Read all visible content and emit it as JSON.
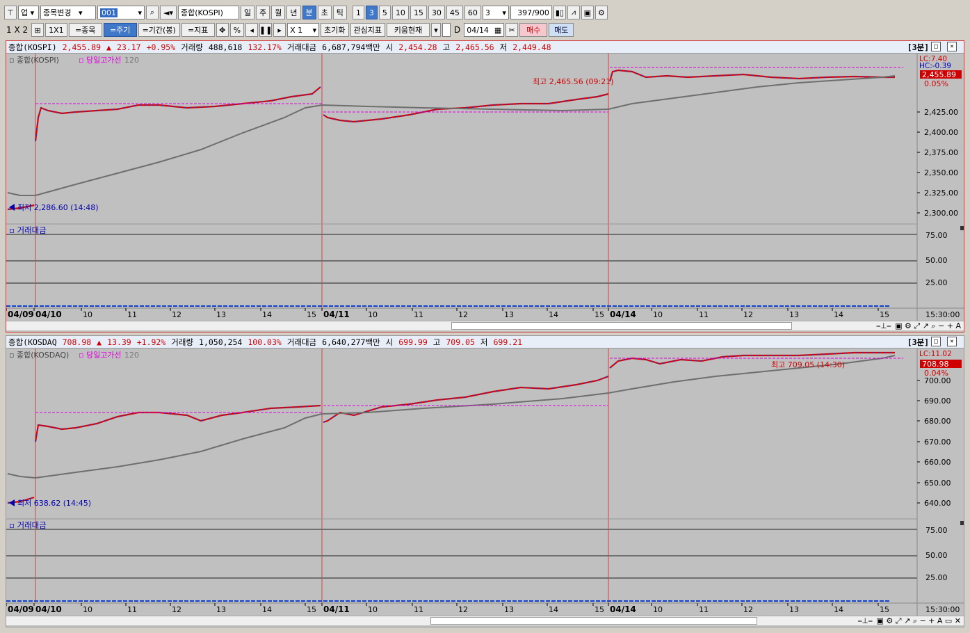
{
  "toolbar1": {
    "market": "업",
    "stock_change": "종목변경",
    "code": "001",
    "name": "종합(KOSPI)",
    "periods": [
      "일",
      "주",
      "월",
      "년",
      "분",
      "초",
      "틱"
    ],
    "active_period": "분",
    "intervals": [
      "1",
      "3",
      "5",
      "10",
      "15",
      "30",
      "45",
      "60"
    ],
    "active_interval": "3",
    "interval_value": "3",
    "count": "397",
    "count_max": "/900"
  },
  "toolbar2": {
    "layout": "1 X 2",
    "grid_btn": "1X1",
    "same_stock": "=종목",
    "same_period": "=주기",
    "same_range": "=기간(봉)",
    "same_indicator": "=지표",
    "percent": "%",
    "multiplier": "X 1",
    "reset": "초기화",
    "watch_indicator": "관심지표",
    "kiwoom_current": "키움현재",
    "d_label": "D",
    "date": "04/14",
    "buy": "매수",
    "sell": "매도"
  },
  "panel1": {
    "name": "종합(KOSPI)",
    "price": "2,455.89",
    "change": "23.17",
    "change_pct": "+0.95%",
    "volume_label": "거래량",
    "volume": "488,618",
    "volume_pct": "132.17%",
    "amount_label": "거래대금",
    "amount": "6,687,794백만",
    "open_label": "시",
    "open": "2,454.28",
    "high_label": "고",
    "high": "2,465.56",
    "low_label": "저",
    "low": "2,449.48",
    "frame": "[3분]",
    "legend_name": "종합(KOSPI)",
    "legend_line": "당일고가선",
    "legend_ma": "120",
    "max_note": "최고 2,465.56 (09:21)",
    "min_note": "최저 2,286.60 (14:48)",
    "lc_label": "LC:7.40",
    "hc_label": "HC:-0.39",
    "price_tag": "2,455.89",
    "pct_tag": "0.05%",
    "y_ticks": [
      "2,425.00",
      "2,400.00",
      "2,375.00",
      "2,350.00",
      "2,325.00",
      "2,300.00"
    ],
    "sub_title": "거래대금",
    "sub_ticks": [
      "75.00",
      "50.00",
      "25.00"
    ],
    "time_label": "15:30:00"
  },
  "panel2": {
    "name": "종합(KOSDAQ",
    "price": "708.98",
    "change": "13.39",
    "change_pct": "+1.92%",
    "volume_label": "거래량",
    "volume": "1,050,254",
    "volume_pct": "100.03%",
    "amount_label": "거래대금",
    "amount": "6,640,277백만",
    "open_label": "시",
    "open": "699.99",
    "high_label": "고",
    "high": "709.05",
    "low_label": "저",
    "low": "699.21",
    "frame": "[3분]",
    "legend_name": "종합(KOSDAQ)",
    "legend_line": "당일고가선",
    "legend_ma": "120",
    "max_note": "최고 709.05 (14:30)",
    "min_note": "최저 638.62 (14:45)",
    "lc_label": "LC:11.02",
    "price_tag": "708.98",
    "pct_tag": "0.04%",
    "y_ticks": [
      "700.00",
      "690.00",
      "680.00",
      "670.00",
      "660.00",
      "650.00",
      "640.00"
    ],
    "sub_title": "거래대금",
    "sub_ticks": [
      "75.00",
      "50.00",
      "25.00"
    ],
    "time_label": "15:30:00"
  },
  "x_axis": [
    "04/09",
    "04/10",
    "10",
    "11",
    "12",
    "13",
    "14",
    "15",
    "04/11",
    "10",
    "11",
    "12",
    "13",
    "14",
    "15",
    "04/14",
    "10",
    "11",
    "12",
    "13",
    "14",
    "15"
  ],
  "colors": {
    "up": "#e00000",
    "down": "#1040d0",
    "ma": "#6e6e6e",
    "high_line": "#e000e0",
    "session": "#d04040"
  }
}
